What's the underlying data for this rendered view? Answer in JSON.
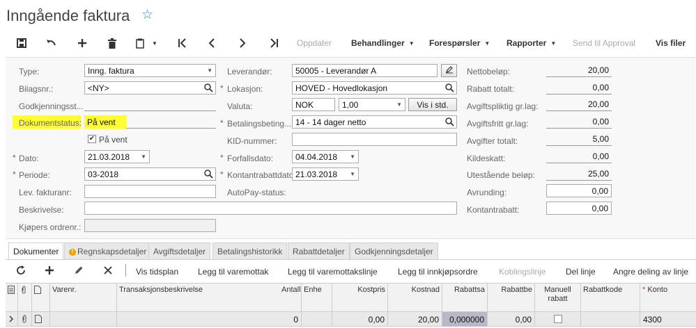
{
  "page": {
    "title": "Inngående faktura"
  },
  "toolbar": {
    "oppdater": "Oppdater",
    "behandlinger": "Behandlinger",
    "foresporsler": "Forespørsler",
    "rapporter": "Rapporter",
    "send_til_approval": "Send til Approval",
    "vis_filer": "Vis filer"
  },
  "form": {
    "type_label": "Type:",
    "type_value": "Inng. faktura",
    "bilagsnr_label": "Bilagsnr.:",
    "bilagsnr_value": "<NY>",
    "godkjenning_label": "Godkjenningsst...",
    "dokumentstatus_label": "Dokumentstatus:",
    "dokumentstatus_value": "På vent",
    "pa_vent_label": "På vent",
    "dato_label": "Dato:",
    "dato_value": "21.03.2018",
    "periode_label": "Periode:",
    "periode_value": "03-2018",
    "lev_fakturanr_label": "Lev. fakturanr:",
    "beskrivelse_label": "Beskrivelse:",
    "kjopers_ordrenr_label": "Kjøpers ordrenr.:",
    "leverandor_label": "Leverandør:",
    "leverandor_value": "50005 - Leverandør A",
    "lokasjon_label": "Lokasjon:",
    "lokasjon_value": "HOVED - Hovedlokasjon",
    "valuta_label": "Valuta:",
    "valuta_value": "NOK",
    "kurs_value": "1,00",
    "vis_i_std": "Vis i std.",
    "betalingsbeting_label": "Betalingsbeting...",
    "betalingsbeting_value": "14 - 14 dager netto",
    "kid_label": "KID-nummer:",
    "forfallsdato_label": "Forfallsdato:",
    "forfallsdato_value": "04.04.2018",
    "kontantrabattdato_label": "Kontantrabattdato:",
    "kontantrabattdato_value": "21.03.2018",
    "autopay_label": "AutoPay-status:",
    "nettobelop_label": "Nettobeløp:",
    "nettobelop_value": "20,00",
    "rabatt_totalt_label": "Rabatt totalt:",
    "rabatt_totalt_value": "0,00",
    "avgiftspliktig_label": "Avgiftspliktig gr.lag:",
    "avgiftspliktig_value": "20,00",
    "avgiftsfritt_label": "Avgiftsfritt gr.lag:",
    "avgiftsfritt_value": "0,00",
    "avgifter_totalt_label": "Avgifter totalt:",
    "avgifter_totalt_value": "5,00",
    "kildeskatt_label": "Kildeskatt:",
    "kildeskatt_value": "0,00",
    "utestaaende_label": "Utestående beløp:",
    "utestaaende_value": "25,00",
    "avrunding_label": "Avrunding:",
    "avrunding_value": "0,00",
    "kontantrabatt_label": "Kontantrabatt:",
    "kontantrabatt_value": "0,00"
  },
  "tabs": [
    {
      "label": "Dokumenter"
    },
    {
      "label": "Regnskapsdetaljer"
    },
    {
      "label": "Avgiftsdetaljer"
    },
    {
      "label": "Betalingshistorikk"
    },
    {
      "label": "Rabattdetaljer"
    },
    {
      "label": "Godkjenningsdetaljer"
    }
  ],
  "grid_toolbar": {
    "vis_tidsplan": "Vis tidsplan",
    "legg_til_varemottak": "Legg til varemottak",
    "legg_til_varemottakslinje": "Legg til varemottakslinje",
    "legg_til_innkjopsordre": "Legg til innkjøpsordre",
    "koblingslinje": "Koblingslinje",
    "del_linje": "Del linje",
    "angre_deling": "Angre deling av linje"
  },
  "grid": {
    "headers": {
      "varenr": "Varenr.",
      "transaksjonsbeskrivelse": "Transaksjonsbeskrivelse",
      "antall": "Antall",
      "enhet": "Enhe",
      "kostpris": "Kostpris",
      "kostnad": "Kostnad",
      "rabattsats": "Rabattsa",
      "rabattbelop": "Rabattbe",
      "manuell_rabatt": "Manuell rabatt",
      "rabattkode": "Rabattkode",
      "konto": "Konto"
    },
    "row": {
      "antall": "0",
      "kostpris": "0,00",
      "kostnad": "20,00",
      "rabattsats": "0,000000",
      "rabattbelop": "0,00",
      "konto": "4300"
    }
  }
}
